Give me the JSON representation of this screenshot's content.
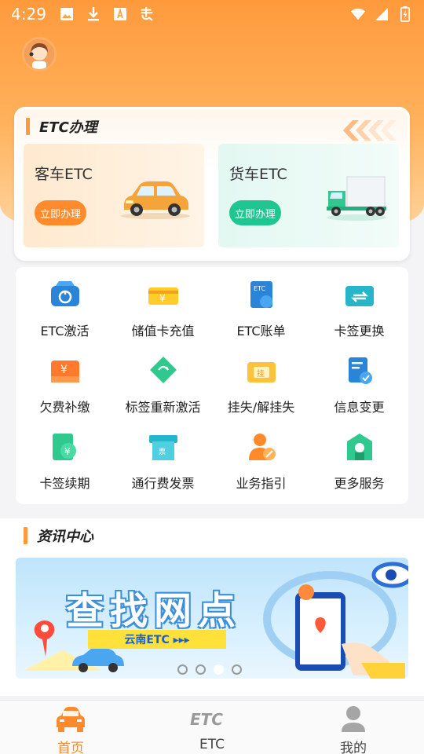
{
  "status_bar": {
    "time": "4:29",
    "left_icons": [
      "image-icon",
      "download-icon",
      "a-box-icon",
      "bug-icon"
    ],
    "right_icons": [
      "wifi-icon",
      "signal-icon",
      "battery-icon"
    ]
  },
  "etc_section": {
    "title": "ETC办理",
    "options": [
      {
        "label": "客车ETC",
        "button": "立即办理"
      },
      {
        "label": "货车ETC",
        "button": "立即办理"
      }
    ]
  },
  "services": [
    {
      "label": "ETC激活",
      "icon": "car-activate-icon"
    },
    {
      "label": "储值卡充值",
      "icon": "card-yuan-icon"
    },
    {
      "label": "ETC账单",
      "icon": "bill-icon"
    },
    {
      "label": "卡签更换",
      "icon": "card-swap-icon"
    },
    {
      "label": "欠费补缴",
      "icon": "arrears-icon"
    },
    {
      "label": "标签重新激活",
      "icon": "tag-reactivate-icon"
    },
    {
      "label": "挂失/解挂失",
      "icon": "report-loss-icon"
    },
    {
      "label": "信息变更",
      "icon": "info-change-icon"
    },
    {
      "label": "卡签续期",
      "icon": "renew-icon"
    },
    {
      "label": "通行费发票",
      "icon": "invoice-icon"
    },
    {
      "label": "业务指引",
      "icon": "guide-icon"
    },
    {
      "label": "更多服务",
      "icon": "more-services-icon"
    }
  ],
  "news": {
    "title": "资讯中心",
    "banner": {
      "headline": "查找网点",
      "sub": "云南ETC ▸▸▸",
      "dots": 4,
      "active_dot": 2
    }
  },
  "tabbar": {
    "tabs": [
      {
        "label": "首页",
        "active": true
      },
      {
        "label": "ETC",
        "active": false
      },
      {
        "label": "我的",
        "active": false
      }
    ],
    "etc_logo_text": "ETC"
  },
  "colors": {
    "accent": "#ff8b2c",
    "green": "#20c690",
    "blue": "#2a84d8"
  }
}
